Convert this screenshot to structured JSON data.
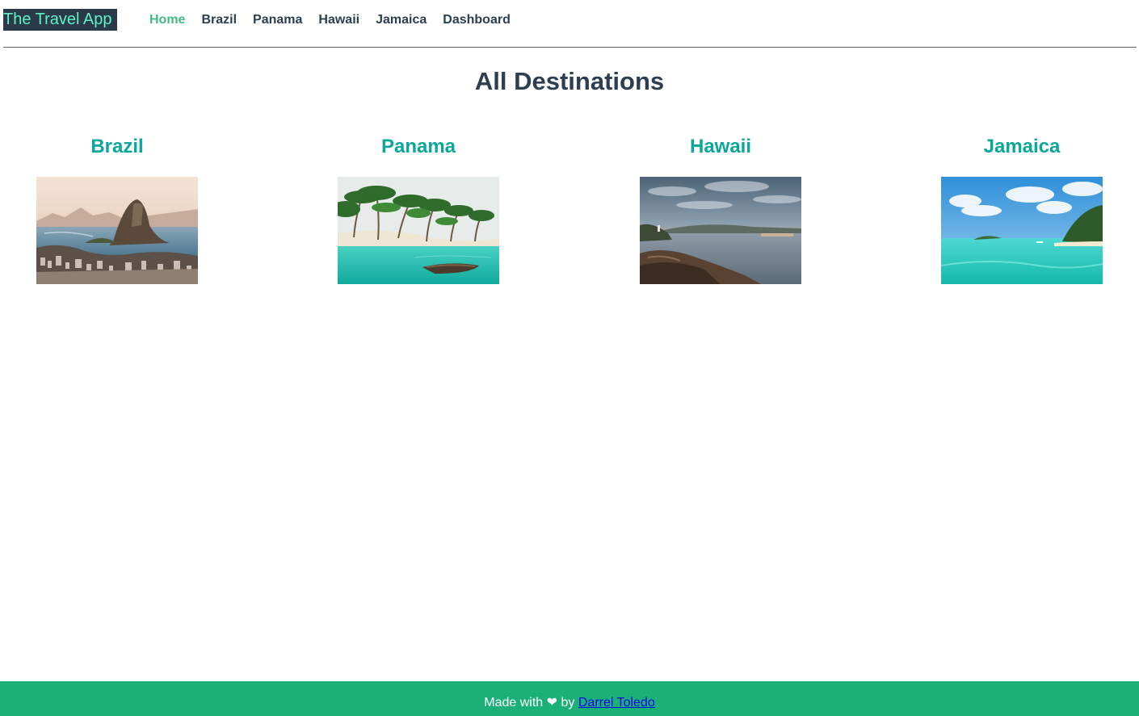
{
  "header": {
    "brand": "The Travel App",
    "nav": [
      "Home",
      "Brazil",
      "Panama",
      "Hawaii",
      "Jamaica",
      "Dashboard"
    ],
    "active_nav": "Home"
  },
  "main": {
    "title": "All Destinations",
    "destinations": [
      {
        "name": "Brazil",
        "image": "rio-de-janeiro-sugarloaf-photo"
      },
      {
        "name": "Panama",
        "image": "palm-beach-canoe-photo"
      },
      {
        "name": "Hawaii",
        "image": "rocky-coast-sunset-photo"
      },
      {
        "name": "Jamaica",
        "image": "turquoise-lagoon-island-photo"
      }
    ]
  },
  "footer": {
    "text_before": "Made with",
    "heart": "❤",
    "text_by": "by",
    "author": "Darrel Toledo"
  },
  "colors": {
    "brand_bg": "#2b3a48",
    "brand_text": "#5ff2c7",
    "nav_active": "#42b983",
    "nav_text": "#2c3e50",
    "destination_title": "#0aa89c",
    "footer_bg": "#1ab077",
    "link": "#0000ee"
  }
}
